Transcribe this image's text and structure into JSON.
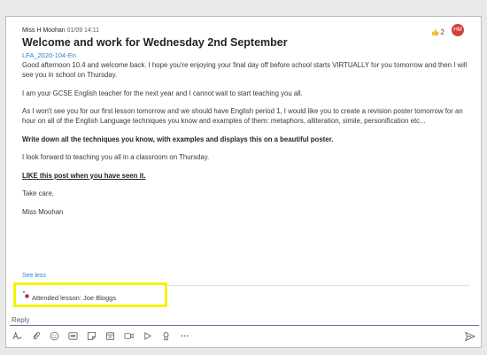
{
  "post": {
    "author": "Miss H Moohan",
    "timestamp": "01/09 14:11",
    "title": "Welcome and work for Wednesday 2nd September",
    "channel": "LFA_2020-104-En",
    "reaction_count": "2",
    "avatar_initials": "HM",
    "paragraphs": {
      "p1": "Good afternoon 10.4 and welcome back. I hope you're enjoying your final day off before school starts VIRTUALLY for you tomorrow and then I will see you in school on Thursday.",
      "p2": "I am your GCSE English teacher for the next year and I cannot wait to start teaching you all.",
      "p3": "As I won't see you for our first lesson tomorrow and we should have English period 1, I would like you to create a revision poster tomorrow for an hour on all of the English Language techniques you know and examples of them: metaphors, alliteration, simile, personification etc...",
      "p4": "Write down all the techniques you know, with examples and displays this on a beautiful poster.",
      "p5": "I look forward to teaching you all in a classroom on Thursday.",
      "p6": "LIKE this post when you have seen it.",
      "p7": "Take care,",
      "p8": "Miss Moohan"
    },
    "see_less": "See less"
  },
  "attendance": {
    "text": "Attended lesson: Joe Bloggs"
  },
  "reply": {
    "placeholder": "Reply"
  },
  "colors": {
    "accent": "#6264a7",
    "link": "#2f7fc9",
    "highlight": "#f4f400"
  },
  "toolbar": {
    "icons": [
      "format-icon",
      "attach-icon",
      "emoji-icon",
      "gif-icon",
      "sticker-icon",
      "schedule-meeting-icon",
      "meet-now-icon",
      "stream-icon",
      "praise-icon",
      "more-options-icon",
      "send-icon"
    ]
  }
}
